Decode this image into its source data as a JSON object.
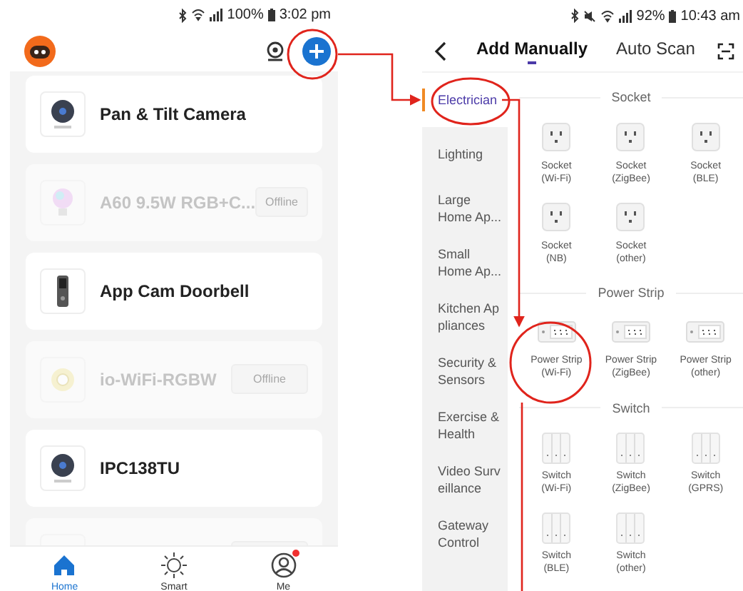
{
  "home_screen": {
    "status_bar": {
      "battery": "100%",
      "time": "3:02 pm"
    },
    "devices": [
      {
        "name": "Pan & Tilt Camera",
        "kind": "camera",
        "online": true
      },
      {
        "name": "A60 9.5W RGB+C...",
        "kind": "bulb",
        "online": false,
        "button": "Offline"
      },
      {
        "name": "App Cam Doorbell",
        "kind": "doorbell",
        "online": true
      },
      {
        "name": "io-WiFi-RGBW",
        "kind": "strip",
        "online": false,
        "button": "Offline"
      },
      {
        "name": "IPC138TU",
        "kind": "camera",
        "online": true
      },
      {
        "kind": "blank",
        "online": false
      }
    ],
    "nav": [
      {
        "label": "Home",
        "kind": "home",
        "selected": true,
        "badge": false
      },
      {
        "label": "Smart",
        "kind": "smart",
        "selected": false,
        "badge": false
      },
      {
        "label": "Me",
        "kind": "me",
        "selected": false,
        "badge": true
      }
    ]
  },
  "add_device_screen": {
    "status_bar": {
      "battery": "92%",
      "time": "10:43 am"
    },
    "tabs": [
      {
        "label": "Add Manually",
        "selected": true
      },
      {
        "label": "Auto Scan",
        "selected": false
      }
    ],
    "categories": [
      {
        "label": "Electrician",
        "selected": true
      },
      {
        "label": "Lighting",
        "selected": false
      },
      {
        "label": "Large\nHome Ap...",
        "selected": false
      },
      {
        "label": "Small\nHome Ap...",
        "selected": false
      },
      {
        "label": "Kitchen Ap\npliances",
        "selected": false
      },
      {
        "label": "Security &\nSensors",
        "selected": false
      },
      {
        "label": "Exercise &\nHealth",
        "selected": false
      },
      {
        "label": "Video Surv\neillance",
        "selected": false
      },
      {
        "label": "Gateway\nControl",
        "selected": false
      }
    ],
    "sections": [
      {
        "title": "Socket",
        "kind": "socket",
        "items": [
          {
            "name": "Socket",
            "variant": "(Wi-Fi)"
          },
          {
            "name": "Socket",
            "variant": "(ZigBee)"
          },
          {
            "name": "Socket",
            "variant": "(BLE)"
          },
          {
            "name": "Socket",
            "variant": "(NB)"
          },
          {
            "name": "Socket",
            "variant": "(other)"
          }
        ]
      },
      {
        "title": "Power Strip",
        "kind": "strip",
        "items": [
          {
            "name": "Power Strip",
            "variant": "(Wi-Fi)"
          },
          {
            "name": "Power Strip",
            "variant": "(ZigBee)"
          },
          {
            "name": "Power Strip",
            "variant": "(other)"
          }
        ]
      },
      {
        "title": "Switch",
        "kind": "switch",
        "items": [
          {
            "name": "Switch",
            "variant": "(Wi-Fi)"
          },
          {
            "name": "Switch",
            "variant": "(ZigBee)"
          },
          {
            "name": "Switch",
            "variant": "(GPRS)"
          },
          {
            "name": "Switch",
            "variant": "(BLE)"
          },
          {
            "name": "Switch",
            "variant": "(other)"
          }
        ]
      }
    ]
  }
}
